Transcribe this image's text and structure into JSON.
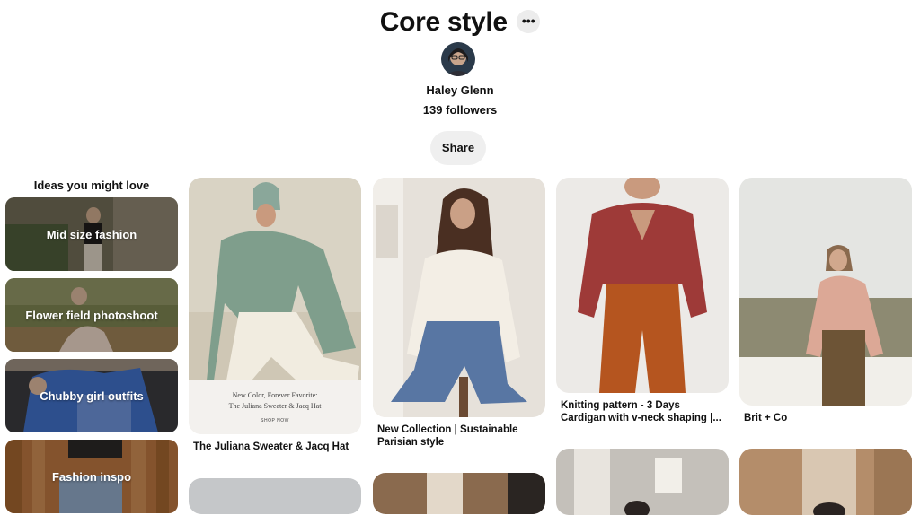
{
  "board": {
    "title": "Core style",
    "more_label": "•••",
    "owner": "Haley Glenn",
    "followers": "139 followers",
    "share_label": "Share"
  },
  "ideas": {
    "heading": "Ideas you might love",
    "items": [
      {
        "label": "Mid size fashion"
      },
      {
        "label": "Flower field photoshoot"
      },
      {
        "label": "Chubby girl outfits"
      },
      {
        "label": "Fashion inspo"
      }
    ]
  },
  "pins": [
    {
      "caption": "The Juliana Sweater & Jacq Hat",
      "ad_line1": "New Color, Forever Favorite:",
      "ad_line2": "The Juliana Sweater & Jacq Hat",
      "ad_cta": "SHOP NOW"
    },
    {
      "caption": "New Collection | Sustainable Parisian style"
    },
    {
      "caption": "Knitting pattern - 3 Days Cardigan with v-neck shaping |..."
    },
    {
      "caption": "Brit + Co"
    }
  ]
}
